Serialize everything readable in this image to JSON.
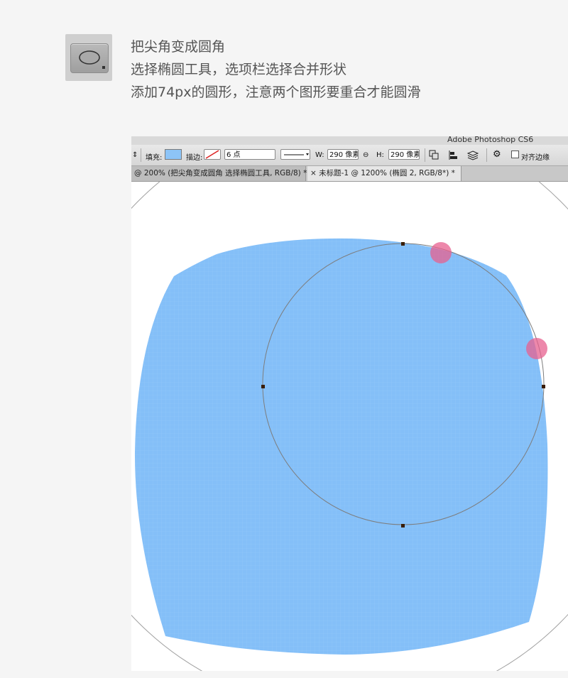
{
  "instructions": {
    "line1": "把尖角变成圆角",
    "line2": "选择椭圆工具，选项栏选择合并形状",
    "line3": "添加74px的圆形，注意两个图形要重合才能圆滑"
  },
  "photoshop": {
    "title": "Adobe Photoshop CS6",
    "options_bar": {
      "fill_label": "填充:",
      "stroke_label": "描边:",
      "stroke_size": "6 点",
      "width_label": "W:",
      "width_value": "290 像素",
      "height_label": "H:",
      "height_value": "290 像素",
      "align_edges_label": "对齐边缘",
      "fill_color": "#8dc4f7"
    },
    "tabs": [
      {
        "label": "@ 200% (把尖角变成圆角 选择椭圆工具, RGB/8) *"
      },
      {
        "label": "× 未标题-1 @ 1200% (椭圆 2, RGB/8*) *"
      }
    ]
  },
  "colors": {
    "shape_fill": "#84bff8",
    "highlight_marker": "#e7608f",
    "path_line": "#8a8a8a"
  },
  "icons": [
    "ellipse-tool-icon",
    "dropdown-arrow-icon",
    "link-icon",
    "path-operations-icon",
    "path-alignment-icon",
    "path-arrangement-icon",
    "gear-icon"
  ]
}
